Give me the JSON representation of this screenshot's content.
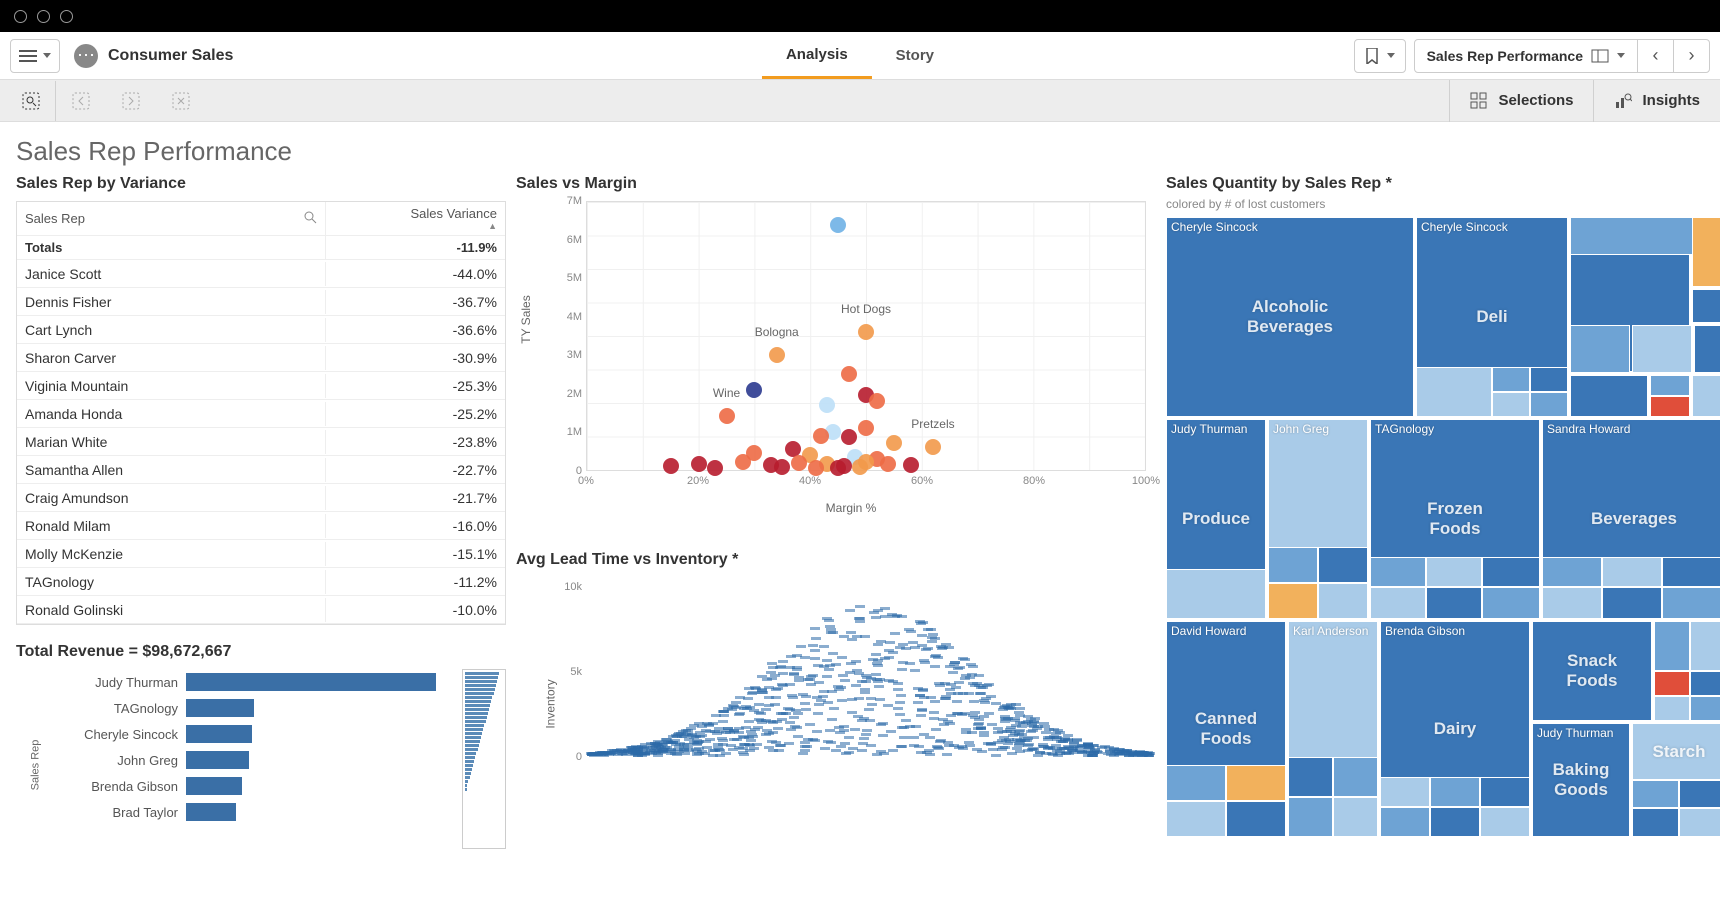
{
  "app": {
    "title": "Consumer Sales"
  },
  "tabs": {
    "analysis": "Analysis",
    "story": "Story",
    "active": "analysis"
  },
  "sheet_nav": {
    "label": "Sales Rep Performance"
  },
  "selbar": {
    "selections": "Selections",
    "insights": "Insights"
  },
  "page": {
    "title": "Sales Rep Performance"
  },
  "variance_table": {
    "title": "Sales Rep by Variance",
    "col_rep": "Sales Rep",
    "col_var": "Sales Variance",
    "totals_label": "Totals",
    "totals_value": "-11.9%",
    "rows": [
      {
        "rep": "Janice Scott",
        "var": "-44.0%"
      },
      {
        "rep": "Dennis Fisher",
        "var": "-36.7%"
      },
      {
        "rep": "Cart Lynch",
        "var": "-36.6%"
      },
      {
        "rep": "Sharon Carver",
        "var": "-30.9%"
      },
      {
        "rep": "Viginia Mountain",
        "var": "-25.3%"
      },
      {
        "rep": "Amanda Honda",
        "var": "-25.2%"
      },
      {
        "rep": "Marian White",
        "var": "-23.8%"
      },
      {
        "rep": "Samantha Allen",
        "var": "-22.7%"
      },
      {
        "rep": "Craig Amundson",
        "var": "-21.7%"
      },
      {
        "rep": "Ronald Milam",
        "var": "-16.0%"
      },
      {
        "rep": "Molly McKenzie",
        "var": "-15.1%"
      },
      {
        "rep": "TAGnology",
        "var": "-11.2%"
      },
      {
        "rep": "Ronald Golinski",
        "var": "-10.0%"
      }
    ]
  },
  "scatter": {
    "title": "Sales vs Margin",
    "ylabel": "TY Sales",
    "xlabel": "Margin %"
  },
  "revenue_bar": {
    "title": "Total Revenue = $98,672,667",
    "ylabel": "Sales Rep"
  },
  "leadtime": {
    "title": "Avg Lead Time vs Inventory *",
    "ylabel": "Inventory"
  },
  "treemap": {
    "title": "Sales Quantity by Sales Rep *",
    "subtitle": "colored by # of lost customers"
  },
  "chart_data": [
    {
      "type": "table",
      "id": "variance_table",
      "title": "Sales Rep by Variance",
      "columns": [
        "Sales Rep",
        "Sales Variance"
      ],
      "totals": [
        "Totals",
        "-11.9%"
      ],
      "rows": [
        [
          "Janice Scott",
          -44.0
        ],
        [
          "Dennis Fisher",
          -36.7
        ],
        [
          "Cart Lynch",
          -36.6
        ],
        [
          "Sharon Carver",
          -30.9
        ],
        [
          "Viginia Mountain",
          -25.3
        ],
        [
          "Amanda Honda",
          -25.2
        ],
        [
          "Marian White",
          -23.8
        ],
        [
          "Samantha Allen",
          -22.7
        ],
        [
          "Craig Amundson",
          -21.7
        ],
        [
          "Ronald Milam",
          -16.0
        ],
        [
          "Molly McKenzie",
          -15.1
        ],
        [
          "TAGnology",
          -11.2
        ],
        [
          "Ronald Golinski",
          -10.0
        ]
      ]
    },
    {
      "type": "scatter",
      "id": "sales_vs_margin",
      "title": "Sales vs Margin",
      "xlabel": "Margin %",
      "ylabel": "TY Sales",
      "xlim": [
        0,
        100
      ],
      "ylim": [
        0,
        7000000
      ],
      "x_ticks": [
        "0%",
        "20%",
        "40%",
        "60%",
        "80%",
        "100%"
      ],
      "y_ticks": [
        "0",
        "1M",
        "2M",
        "3M",
        "4M",
        "5M",
        "6M",
        "7M"
      ],
      "annotations": [
        {
          "label": "Hot Dogs",
          "x": 50,
          "y": 3600000
        },
        {
          "label": "Bologna",
          "x": 34,
          "y": 3000000
        },
        {
          "label": "Wine",
          "x": 25,
          "y": 1400000
        },
        {
          "label": "Pretzels",
          "x": 62,
          "y": 600000
        }
      ],
      "points": [
        {
          "x": 45,
          "y": 6400000,
          "c": "#6fb1e5"
        },
        {
          "x": 50,
          "y": 3600000,
          "c": "#f2994a"
        },
        {
          "x": 34,
          "y": 3000000,
          "c": "#f2994a"
        },
        {
          "x": 47,
          "y": 2500000,
          "c": "#ed6a45"
        },
        {
          "x": 30,
          "y": 2100000,
          "c": "#2b3a8f"
        },
        {
          "x": 50,
          "y": 1950000,
          "c": "#b71c2e"
        },
        {
          "x": 52,
          "y": 1800000,
          "c": "#ed6a45"
        },
        {
          "x": 43,
          "y": 1700000,
          "c": "#bcdff7"
        },
        {
          "x": 25,
          "y": 1400000,
          "c": "#ed6a45"
        },
        {
          "x": 50,
          "y": 1100000,
          "c": "#ed6a45"
        },
        {
          "x": 44,
          "y": 1000000,
          "c": "#bcdff7"
        },
        {
          "x": 42,
          "y": 900000,
          "c": "#ed6a45"
        },
        {
          "x": 47,
          "y": 850000,
          "c": "#b71c2e"
        },
        {
          "x": 55,
          "y": 700000,
          "c": "#f2994a"
        },
        {
          "x": 62,
          "y": 600000,
          "c": "#f2994a"
        },
        {
          "x": 37,
          "y": 550000,
          "c": "#b71c2e"
        },
        {
          "x": 30,
          "y": 450000,
          "c": "#ed6a45"
        },
        {
          "x": 40,
          "y": 400000,
          "c": "#f2994a"
        },
        {
          "x": 48,
          "y": 350000,
          "c": "#bcdff7"
        },
        {
          "x": 52,
          "y": 300000,
          "c": "#ed6a45"
        },
        {
          "x": 20,
          "y": 150000,
          "c": "#b71c2e"
        },
        {
          "x": 15,
          "y": 100000,
          "c": "#b71c2e"
        },
        {
          "x": 28,
          "y": 200000,
          "c": "#ed6a45"
        },
        {
          "x": 33,
          "y": 120000,
          "c": "#b71c2e"
        },
        {
          "x": 38,
          "y": 180000,
          "c": "#ed6a45"
        },
        {
          "x": 43,
          "y": 150000,
          "c": "#f2994a"
        },
        {
          "x": 46,
          "y": 100000,
          "c": "#b71c2e"
        },
        {
          "x": 50,
          "y": 200000,
          "c": "#f2994a"
        },
        {
          "x": 54,
          "y": 150000,
          "c": "#ed6a45"
        },
        {
          "x": 58,
          "y": 120000,
          "c": "#b71c2e"
        },
        {
          "x": 35,
          "y": 80000,
          "c": "#b71c2e"
        },
        {
          "x": 41,
          "y": 60000,
          "c": "#ed6a45"
        },
        {
          "x": 45,
          "y": 50000,
          "c": "#b71c2e"
        },
        {
          "x": 49,
          "y": 80000,
          "c": "#f2994a"
        },
        {
          "x": 23,
          "y": 50000,
          "c": "#b71c2e"
        }
      ]
    },
    {
      "type": "bar",
      "id": "total_revenue",
      "orientation": "horizontal",
      "title": "Total Revenue = $98,672,667",
      "ylabel": "Sales Rep",
      "xlim": [
        0,
        20000000
      ],
      "categories": [
        "Judy Thurman",
        "TAGnology",
        "Cheryle Sincock",
        "John Greg",
        "Brenda Gibson",
        "Brad Taylor"
      ],
      "values": [
        19000000,
        5200000,
        5000000,
        4800000,
        4300000,
        3800000
      ]
    },
    {
      "type": "scatter",
      "id": "leadtime_inventory",
      "title": "Avg Lead Time vs Inventory *",
      "ylabel": "Inventory",
      "ylim": [
        0,
        10000
      ],
      "y_ticks": [
        "0",
        "5k",
        "10k"
      ],
      "note": "dense density-style scatter, values approximate"
    },
    {
      "type": "treemap",
      "id": "sales_qty_treemap",
      "title": "Sales Quantity by Sales Rep *",
      "subtitle": "colored by # of lost customers",
      "color_meaning": "# of lost customers",
      "groups": [
        {
          "rep": "Cheryle Sincock",
          "category": "Alcoholic Beverages"
        },
        {
          "rep": "Cheryle Sincock",
          "category": "Deli"
        },
        {
          "rep": "Judy Thurman",
          "category": "Produce"
        },
        {
          "rep": "John Greg",
          "category": ""
        },
        {
          "rep": "TAGnology",
          "category": "Frozen Foods"
        },
        {
          "rep": "Sandra Howard",
          "category": "Beverages"
        },
        {
          "rep": "David Howard",
          "category": "Canned Foods"
        },
        {
          "rep": "Karl Anderson",
          "category": ""
        },
        {
          "rep": "Brenda Gibson",
          "category": "Dairy"
        },
        {
          "rep": "Judy Thurman",
          "category": "Baking Goods"
        },
        {
          "rep": "",
          "category": "Snack Foods"
        },
        {
          "rep": "",
          "category": "Starch"
        }
      ]
    }
  ]
}
